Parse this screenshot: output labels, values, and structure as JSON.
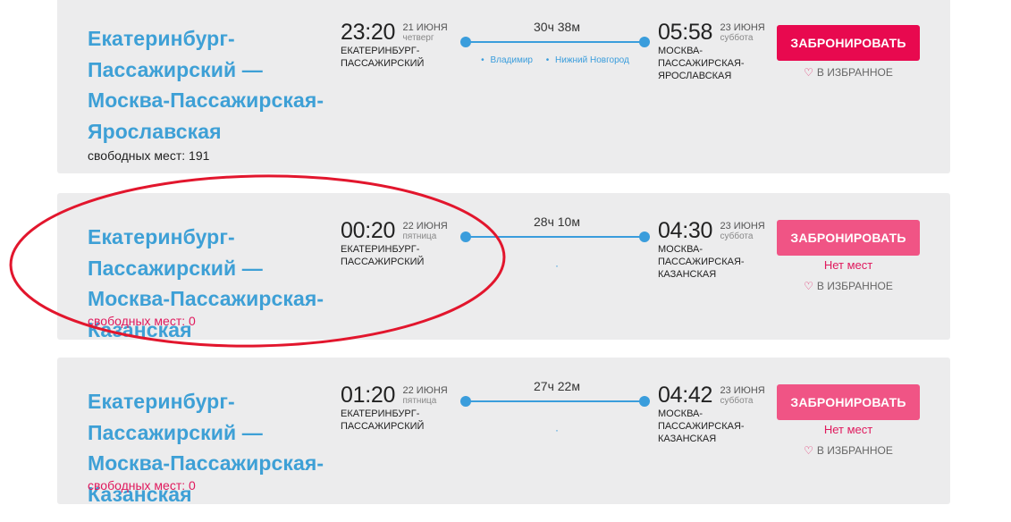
{
  "labels": {
    "book": "ЗАБРОНИРОВАТЬ",
    "no_seats": "Нет мест",
    "favorite": "В ИЗБРАННОЕ",
    "seats_prefix": "свободных мест: "
  },
  "colors": {
    "link": "#3ea0d6",
    "accent": "#e8094f",
    "track": "#3a9ddc",
    "highlight": "#e2162d"
  },
  "trains": [
    {
      "route": "Екатеринбург-Пассажирский — Москва-Пассажирская-Ярославская",
      "seats": "191",
      "dep_time": "23:20",
      "dep_date": "21 ИЮНЯ",
      "dep_wday": "четверг",
      "dep_station_1": "ЕКАТЕРИНБУРГ-",
      "dep_station_2": "ПАССАЖИРСКИЙ",
      "duration": "30ч 38м",
      "stops": [
        "Владимир",
        "Нижний Новгород"
      ],
      "arr_time": "05:58",
      "arr_date": "23 ИЮНЯ",
      "arr_wday": "суббота",
      "arr_station_1": "МОСКВА-",
      "arr_station_2": "ПАССАЖИРСКАЯ-",
      "arr_station_3": "ЯРОСЛАВСКАЯ"
    },
    {
      "route": "Екатеринбург-Пассажирский — Москва-Пассажирская-Казанская",
      "seats": "0",
      "dep_time": "00:20",
      "dep_date": "22 ИЮНЯ",
      "dep_wday": "пятница",
      "dep_station_1": "ЕКАТЕРИНБУРГ-",
      "dep_station_2": "ПАССАЖИРСКИЙ",
      "duration": "28ч 10м",
      "arr_time": "04:30",
      "arr_date": "23 ИЮНЯ",
      "arr_wday": "суббота",
      "arr_station_1": "МОСКВА-",
      "arr_station_2": "ПАССАЖИРСКАЯ-",
      "arr_station_3": "КАЗАНСКАЯ"
    },
    {
      "route": "Екатеринбург-Пассажирский — Москва-Пассажирская-Казанская",
      "seats": "0",
      "dep_time": "01:20",
      "dep_date": "22 ИЮНЯ",
      "dep_wday": "пятница",
      "dep_station_1": "ЕКАТЕРИНБУРГ-",
      "dep_station_2": "ПАССАЖИРСКИЙ",
      "duration": "27ч 22м",
      "arr_time": "04:42",
      "arr_date": "23 ИЮНЯ",
      "arr_wday": "суббота",
      "arr_station_1": "МОСКВА-",
      "arr_station_2": "ПАССАЖИРСКАЯ-",
      "arr_station_3": "КАЗАНСКАЯ"
    }
  ]
}
